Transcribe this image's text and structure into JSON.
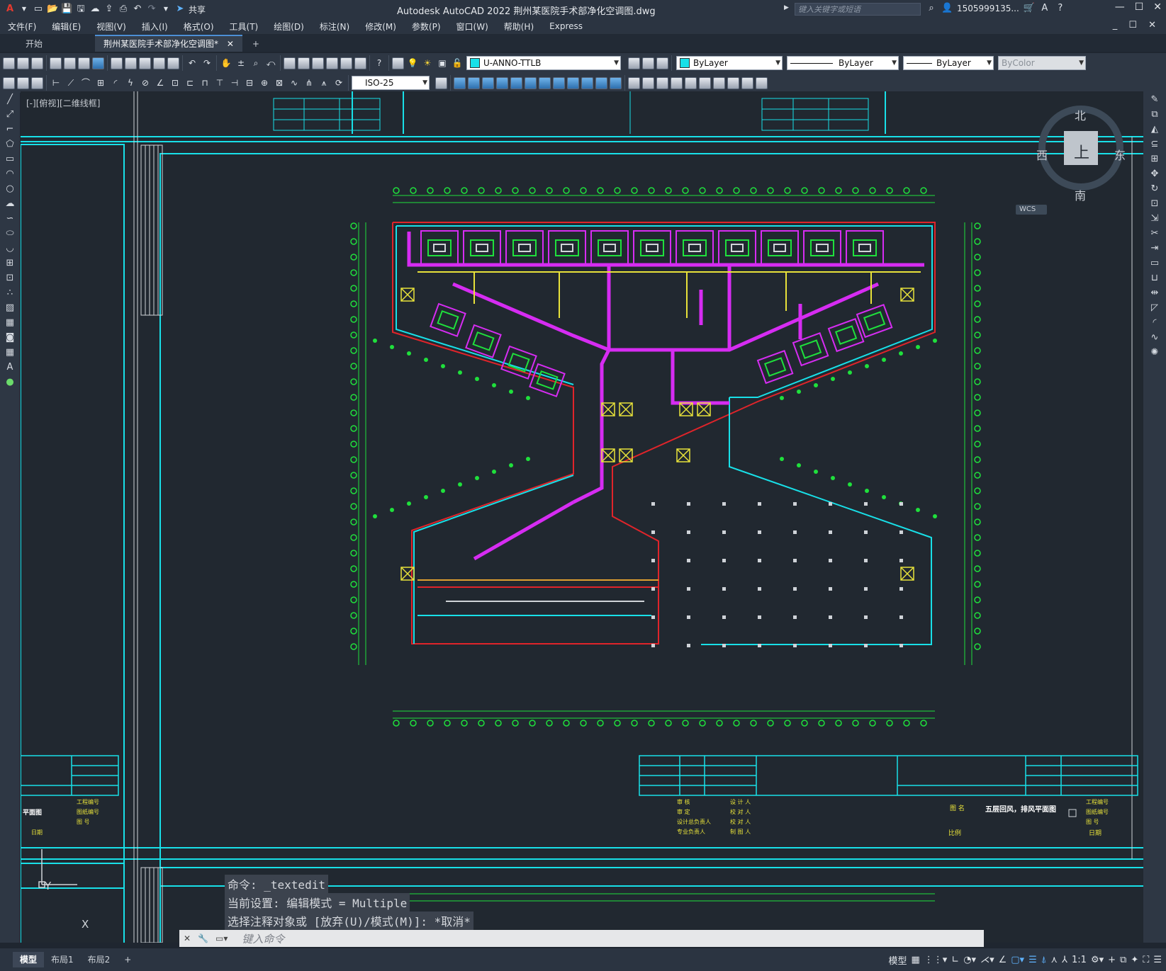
{
  "titlebar": {
    "app_title": "Autodesk AutoCAD 2022     荆州某医院手术部净化空调图.dwg",
    "share_label": "共享",
    "search_placeholder": "键入关键字或短语",
    "user_name": "1505999135..."
  },
  "menus": [
    "文件(F)",
    "编辑(E)",
    "视图(V)",
    "插入(I)",
    "格式(O)",
    "工具(T)",
    "绘图(D)",
    "标注(N)",
    "修改(M)",
    "参数(P)",
    "窗口(W)",
    "帮助(H)",
    "Express"
  ],
  "tabs": {
    "start": "开始",
    "document": "荆州某医院手术部净化空调图*",
    "close": "✕",
    "new": "+"
  },
  "layer_combo": {
    "name": "U-ANNO-TTLB",
    "color": "#18e0e8"
  },
  "color_combo": {
    "label": "ByLayer",
    "color": "#18e0e8"
  },
  "linetype_combo": "ByLayer",
  "lineweight_combo": "ByLayer",
  "plotstyle_combo": "ByColor",
  "dimstyle_combo": "ISO-25",
  "viewport_label": "[-][俯视][二维线框]",
  "viewcube": {
    "north": "北",
    "south": "南",
    "east": "东",
    "west": "西",
    "face": "上",
    "wcs": "WCS"
  },
  "ucs": {
    "x": "X",
    "y": "Y"
  },
  "titleblock": {
    "left_rows": [
      "工程编号",
      "图纸编号",
      "图 号"
    ],
    "left_label": "平面图",
    "left_date": "日期",
    "sig_left": [
      "审 核",
      "审 定",
      "设计总负责人",
      "专业负责人"
    ],
    "sig_right": [
      "设 计 人",
      "校 对 人",
      "校 对 人",
      "制 图 人"
    ],
    "drawing_name_label": "图 名",
    "drawing_name": "五层回风，排风平面图",
    "right_rows": [
      "工程编号",
      "图纸编号",
      "图 号"
    ],
    "scale_label": "比例",
    "date_label": "日期"
  },
  "command_history": [
    "命令:  _textedit",
    "当前设置: 编辑模式 = Multiple",
    "选择注释对象或 [放弃(U)/模式(M)]: *取消*"
  ],
  "command_placeholder": "键入命令",
  "status_tabs": [
    "模型",
    "布局1",
    "布局2",
    "+"
  ],
  "status_right": {
    "model": "模型",
    "scale": "1:1"
  },
  "colors": {
    "cyan": "#18e0e8",
    "green": "#1fe03c",
    "magenta": "#d62cf2",
    "red": "#e0242a",
    "yellow": "#e8e23a",
    "white": "#e6e6e6",
    "canvas": "#212830"
  }
}
